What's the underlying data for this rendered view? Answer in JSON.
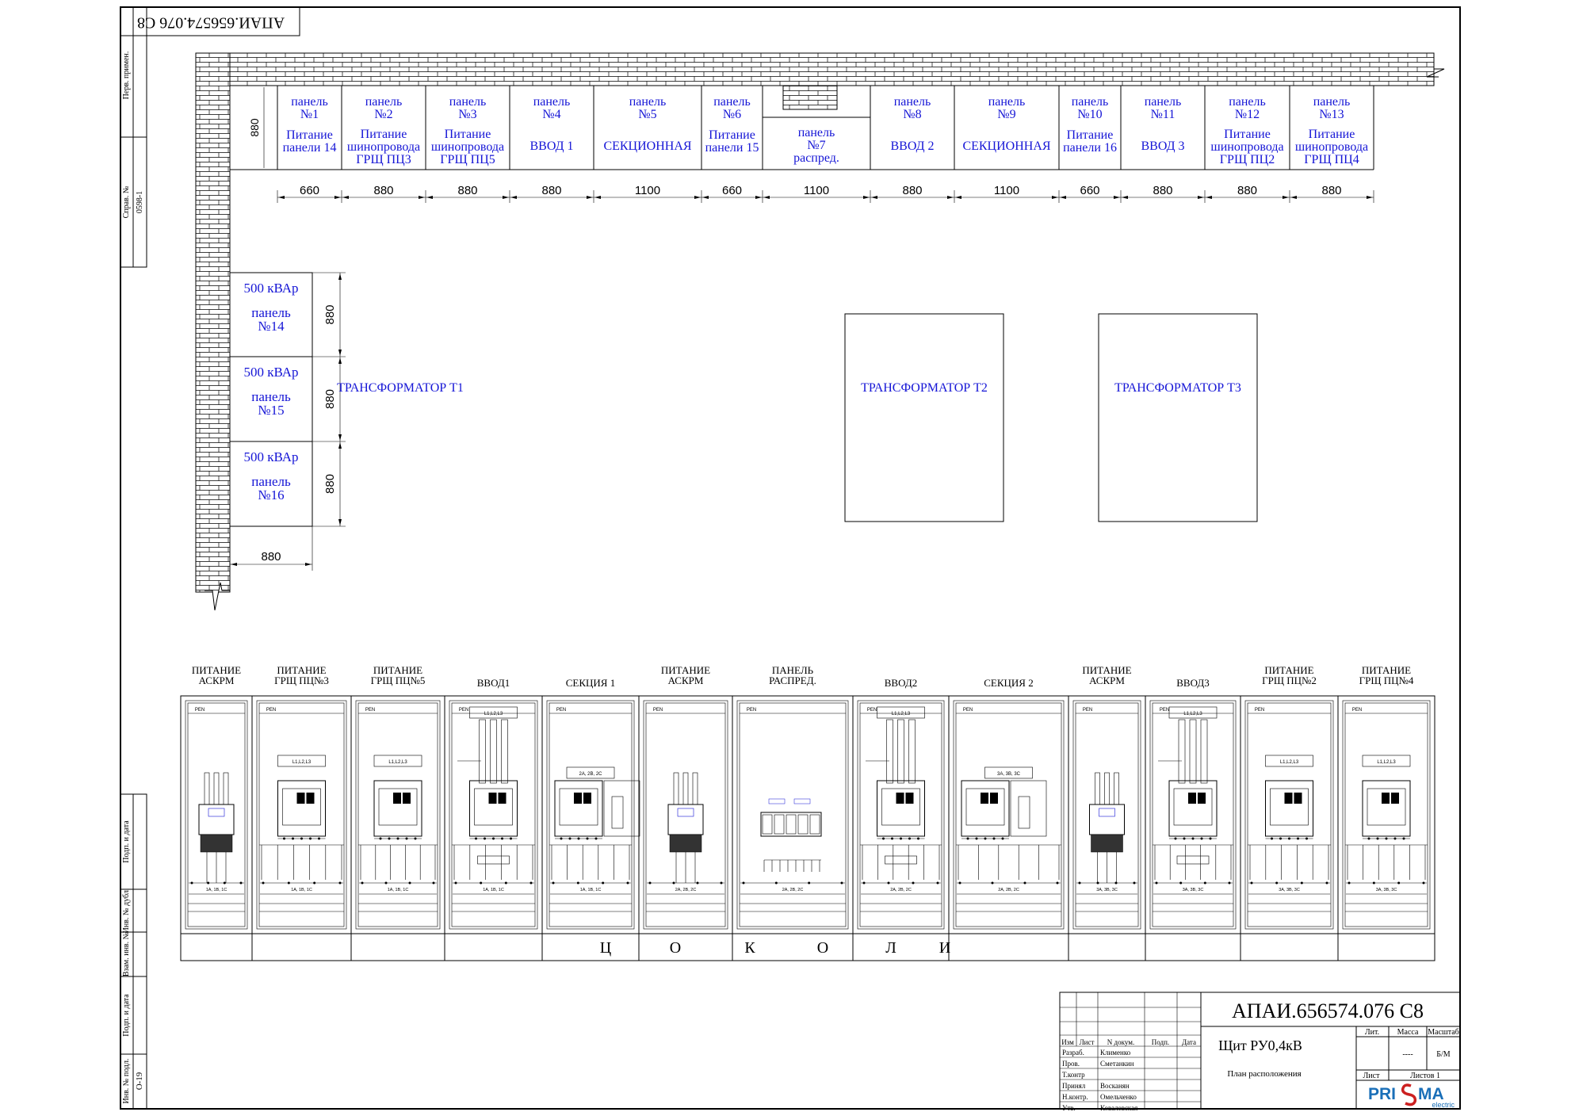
{
  "doc_code_rotated": "АПАИ.656574.076 С8",
  "side_stamp": {
    "perv_primen": "Перв. примен.",
    "sprav_no": "Справ. №",
    "sprav_value": "0598-1",
    "podp_data_1": "Подп. и дата",
    "inv_dubl": "Инв. № дубл.",
    "vzam_inv": "Взам. инв. №",
    "podp_data_2": "Подп. и дата",
    "inv_podl": "Инв. № подл.",
    "inv_podl_value": "O-19"
  },
  "plan": {
    "row_height_label": "880",
    "panels": [
      {
        "number": "панель\n№1",
        "title": "Питание\nпанели 14",
        "width": "660"
      },
      {
        "number": "панель\n№2",
        "title": "Питание\nшинопровода\nГРЩ ПЦ3",
        "width": "880"
      },
      {
        "number": "панель\n№3",
        "title": "Питание\nшинопровода\nГРЩ ПЦ5",
        "width": "880"
      },
      {
        "number": "панель\n№4",
        "title": "ВВОД 1",
        "width": "880"
      },
      {
        "number": "панель\n№5",
        "title": "СЕКЦИОННАЯ",
        "width": "1100"
      },
      {
        "number": "панель\n№6",
        "title": "Питание\nпанели 15",
        "width": "660"
      },
      {
        "number": "",
        "title": "панель\n№7\nраспред.",
        "width": "1100"
      },
      {
        "number": "панель\n№8",
        "title": "ВВОД 2",
        "width": "880"
      },
      {
        "number": "панель\n№9",
        "title": "СЕКЦИОННАЯ",
        "width": "1100"
      },
      {
        "number": "панель\n№10",
        "title": "Питание\nпанели 16",
        "width": "660"
      },
      {
        "number": "панель\n№11",
        "title": "ВВОД 3",
        "width": "880"
      },
      {
        "number": "панель\n№12",
        "title": "Питание\nшинопровода\nГРЩ ПЦ2",
        "width": "880"
      },
      {
        "number": "панель\n№13",
        "title": "Питание\nшинопровода\nГРЩ ПЦ4",
        "width": "880"
      }
    ],
    "side_panels": [
      {
        "power": "500 кВАр",
        "name": "панель\n№14",
        "height": "880"
      },
      {
        "power": "500 кВАр",
        "name": "панель\n№15",
        "height": "880"
      },
      {
        "power": "500 кВАр",
        "name": "панель\n№16",
        "height": "880"
      }
    ],
    "side_width_label": "880",
    "transformers": [
      "ТРАНСФОРМАТОР  Т1",
      "ТРАНСФОРМАТОР  Т2",
      "ТРАНСФОРМАТОР  Т3"
    ]
  },
  "elevation": {
    "sections": [
      {
        "label": "ПИТАНИЕ\nАСКРМ",
        "type": "askrm",
        "bus": "PEN",
        "bottom": "1А, 1В, 1С"
      },
      {
        "label": "ПИТАНИЕ\nГРЩ ПЦ№3",
        "type": "feeder",
        "bus": "PEN",
        "top": "L1,L2,L3",
        "bottom": "1А, 1В, 1С"
      },
      {
        "label": "ПИТАНИЕ\nГРЩ ПЦ№5",
        "type": "feeder",
        "bus": "PEN",
        "top": "L1,L2,L3",
        "bottom": "1А, 1В, 1С"
      },
      {
        "label": "ВВОД1",
        "type": "input",
        "bus": "PEN",
        "top": "L1,L2,L3",
        "bottom": "1А, 1В, 1С"
      },
      {
        "label": "СЕКЦИЯ 1",
        "type": "section",
        "bus": "PEN",
        "top": "2А, 2В, 2С",
        "bottom": "1А, 1В, 1С"
      },
      {
        "label": "ПИТАНИЕ\nАСКРМ",
        "type": "askrm",
        "bus": "PEN",
        "bottom": "2А, 2В, 2С"
      },
      {
        "label": "ПАНЕЛЬ\nРАСПРЕД.",
        "type": "distrib",
        "bus": "PEN",
        "bottom": "2А, 2В, 2С"
      },
      {
        "label": "ВВОД2",
        "type": "input",
        "bus": "PEN",
        "top": "L1,L2,L3",
        "bottom": "2А, 2В, 2С"
      },
      {
        "label": "СЕКЦИЯ 2",
        "type": "section",
        "bus": "PEN",
        "top": "3А, 3В, 3С",
        "bottom": "2А, 2В, 2С"
      },
      {
        "label": "ПИТАНИЕ\nАСКРМ",
        "type": "askrm",
        "bus": "PEN",
        "bottom": "3А, 3В, 3С"
      },
      {
        "label": "ВВОД3",
        "type": "input",
        "bus": "PEN",
        "top": "L1,L2,L3",
        "bottom": "3А, 3В, 3С"
      },
      {
        "label": "ПИТАНИЕ\nГРЩ ПЦ№2",
        "type": "feeder",
        "bus": "PEN",
        "top": "L1,L2,L3",
        "bottom": "3А, 3В, 3С"
      },
      {
        "label": "ПИТАНИЕ\nГРЩ ПЦ№4",
        "type": "feeder",
        "bus": "PEN",
        "top": "L1,L2,L3",
        "bottom": "3А, 3В, 3С"
      }
    ],
    "plinth_letters": [
      "Ц",
      "О",
      "К",
      "О",
      "Л",
      "И"
    ]
  },
  "title_block": {
    "code": "АПАИ.656574.076  С8",
    "name": "Щит РУ0,4кВ",
    "subtitle": "План расположения",
    "header": {
      "izm": "Изм",
      "list": "Лист",
      "doc": "N докум.",
      "podp": "Подп.",
      "date": "Дата"
    },
    "rows": [
      {
        "role": "Разраб.",
        "person": "Клименко"
      },
      {
        "role": "Пров.",
        "person": "Сметанкин"
      },
      {
        "role": "Т.контр",
        "person": ""
      },
      {
        "role": "Принял",
        "person": "Восканян"
      },
      {
        "role": "Н.контр.",
        "person": "Омельченко"
      },
      {
        "role": "Утв.",
        "person": "Ковалевская"
      }
    ],
    "lit": "Лит.",
    "massa": "Масса",
    "masshtab": "Масштаб",
    "massa_val": "----",
    "masshtab_val": "Б/М",
    "list_label": "Лист",
    "listov_label": "Листов 1",
    "logo_a": "PRI",
    "logo_b": "MA",
    "logo_sub": "electric"
  }
}
